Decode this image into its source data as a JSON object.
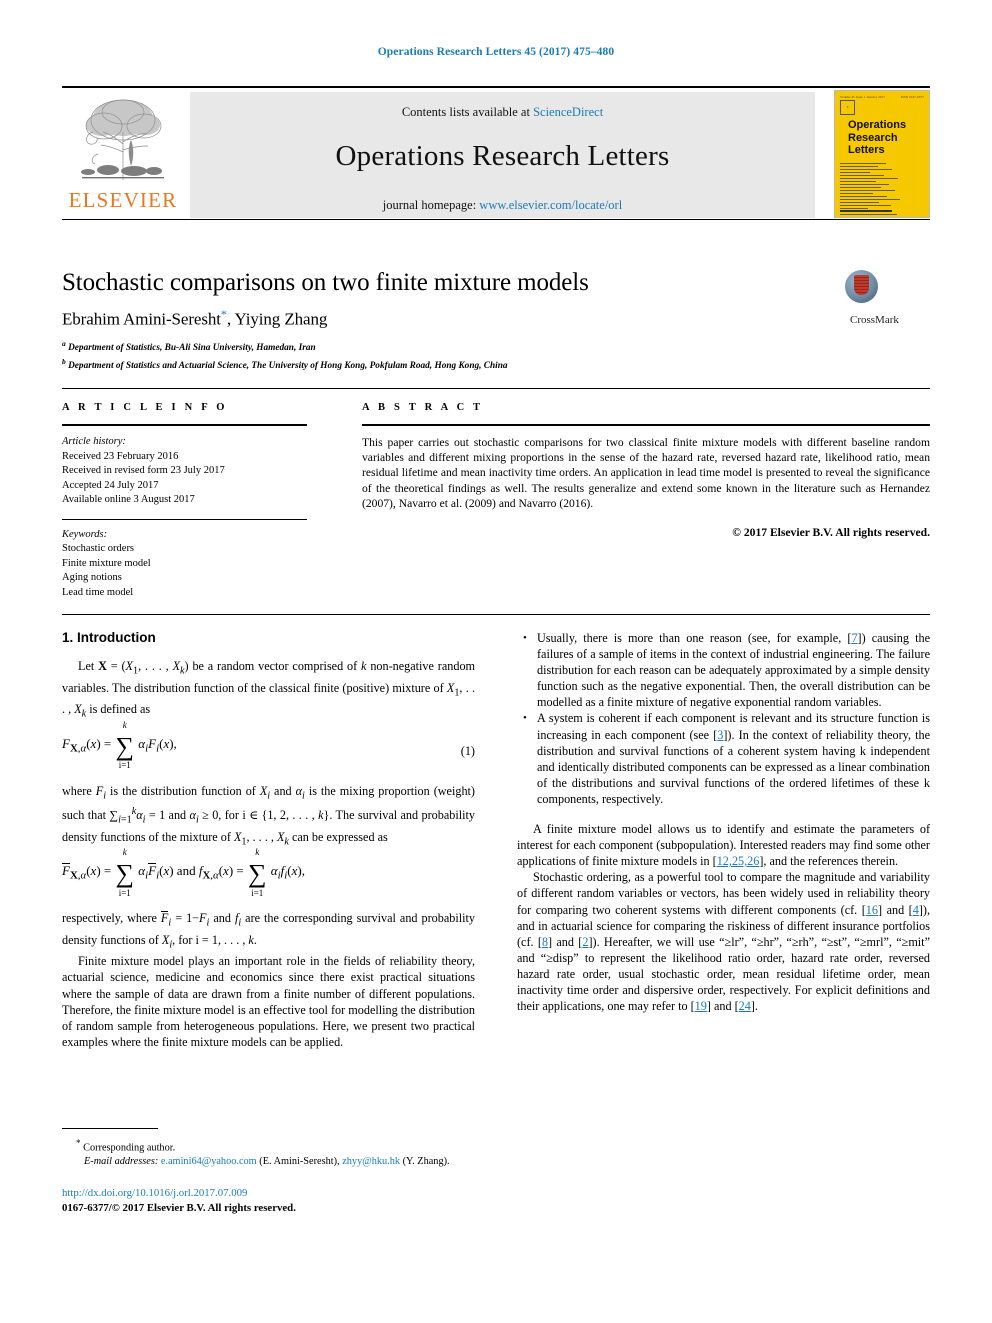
{
  "running_head": "Operations Research Letters 45 (2017) 475–480",
  "masthead": {
    "publisher_name": "ELSEVIER",
    "contents_prefix": "Contents lists available at",
    "contents_link": "ScienceDirect",
    "journal_title": "Operations Research Letters",
    "homepage_prefix": "journal homepage:",
    "homepage_link": "www.elsevier.com/locate/orl",
    "cover": {
      "title_line1": "Operations",
      "title_line2": "Research",
      "title_line3": "Letters",
      "top_left": "Volume 45 Issue 1 January 2017",
      "top_right": "ISSN 0167-6377"
    }
  },
  "article": {
    "title": "Stochastic comparisons on two finite mixture models",
    "authors": "Ebrahim Amini-Seresht",
    "authors_second": ", Yiying Zhang",
    "affiliation_a": "Department of Statistics, Bu-Ali Sina University, Hamedan, Iran",
    "affiliation_b": "Department of Statistics and Actuarial Science, The University of Hong Kong, Pokfulam Road, Hong Kong, China",
    "crossmark_label": "CrossMark"
  },
  "article_info": {
    "heading": "A R T I C L E   I N F O",
    "history_label": "Article history:",
    "history": [
      "Received 23 February 2016",
      "Received in revised form 23 July 2017",
      "Accepted 24 July 2017",
      "Available online 3 August 2017"
    ],
    "keywords_label": "Keywords:",
    "keywords": [
      "Stochastic orders",
      "Finite mixture model",
      "Aging notions",
      "Lead time model"
    ]
  },
  "abstract": {
    "heading": "A B S T R A C T",
    "text": "This paper carries out stochastic comparisons for two classical finite mixture models with different baseline random variables and different mixing proportions in the sense of the hazard rate, reversed hazard rate, likelihood ratio, mean residual lifetime and mean inactivity time orders. An application in lead time model is presented to reveal the significance of the theoretical findings as well. The results generalize and extend some known in the literature such as Hernandez (2007), Navarro et al. (2009) and Navarro (2016).",
    "copyright": "© 2017 Elsevier B.V. All rights reserved."
  },
  "body": {
    "section_title": "1. Introduction",
    "p1_a": "Let ",
    "p1_b": " be a random vector comprised of ",
    "p1_c": " non-negative random variables. The distribution function of the classical finite (positive) mixture of ",
    "p1_d": " is defined as",
    "eq1_number": "(1)",
    "p2": "where Fi is the distribution function of Xi and αi is the mixing proportion (weight) such that ∑ αi = 1 and αi ≥ 0, for i ∈ {1, 2, . . . , k}. The survival and probability density functions of the mixture of X1, . . . , Xk can be expressed as",
    "p3": "respectively, where F̄i = 1−Fi and fi are the corresponding survival and probability density functions of Xi, for i = 1, . . . , k.",
    "p4": "Finite mixture model plays an important role in the fields of reliability theory, actuarial science, medicine and economics since there exist practical situations where the sample of data are drawn from a finite number of different populations. Therefore, the finite mixture model is an effective tool for modelling the distribution of random sample from heterogeneous populations. Here, we present two practical examples where the finite mixture models can be applied.",
    "bullet1_pre": "Usually, there is more than one reason (see, for example, [",
    "bullet1_ref": "7",
    "bullet1_post": "]) causing the failures of a sample of items in the context of industrial engineering. The failure distribution for each reason can be adequately approximated by a simple density function such as the negative exponential. Then, the overall distribution can be modelled as a finite mixture of negative exponential random variables.",
    "bullet2_pre": "A system is coherent if each component is relevant and its structure function is increasing in each component (see [",
    "bullet2_ref": "3",
    "bullet2_post": "]). In the context of reliability theory, the distribution and survival functions of a coherent system having k independent and identically distributed components can be expressed as a linear combination of the distributions and survival functions of the ordered lifetimes of these k components, respectively.",
    "p5_pre": "A finite mixture model allows us to identify and estimate the parameters of interest for each component (subpopulation). Interested readers may find some other applications of finite mixture models in [",
    "p5_ref": "12,25,26",
    "p5_post": "], and the references therein.",
    "p6_a": "Stochastic ordering, as a powerful tool to compare the magnitude and variability of different random variables or vectors, has been widely used in reliability theory for comparing two coherent systems with different components (cf. [",
    "p6_r1": "16",
    "p6_b": "] and [",
    "p6_r2": "4",
    "p6_c": "]), and in actuarial science for comparing the riskiness of different insurance portfolios (cf. [",
    "p6_r3": "8",
    "p6_d": "] and [",
    "p6_r4": "2",
    "p6_e": "]). Hereafter, we will use “≥lr”, “≥hr”, “≥rh”, “≥st”, “≥mrl”, “≥mit” and “≥disp” to represent the likelihood ratio order, hazard rate order, reversed hazard rate order, usual stochastic order, mean residual lifetime order, mean inactivity time order and dispersive order, respectively. For explicit definitions and their applications, one may refer to [",
    "p6_r5": "19",
    "p6_f": "] and [",
    "p6_r6": "24",
    "p6_g": "]."
  },
  "footnote": {
    "corresponding": "Corresponding author.",
    "emails_label": "E-mail addresses:",
    "email1": "e.amini64@yahoo.com",
    "email1_owner": "(E. Amini-Seresht),",
    "email2": "zhyy@hku.hk",
    "email2_owner": "(Y. Zhang).",
    "doi": "http://dx.doi.org/10.1016/j.orl.2017.07.009",
    "issn_line": "0167-6377/© 2017 Elsevier B.V. All rights reserved."
  },
  "colors": {
    "link": "#1a7bb9",
    "elsevier_orange": "#e87722",
    "cover_yellow": "#f5c800",
    "banner_gray": "#e8e8e8"
  }
}
